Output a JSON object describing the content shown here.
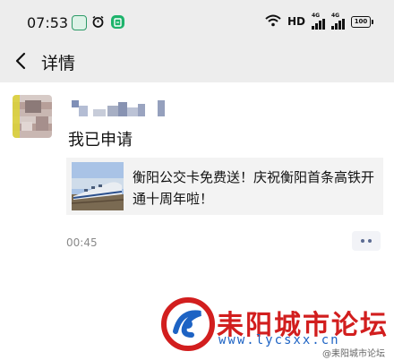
{
  "status_bar": {
    "time": "07:53",
    "hd_label": "HD",
    "signal_label_1": "4G",
    "signal_label_2": "4G",
    "battery": "100"
  },
  "nav": {
    "title": "详情"
  },
  "post": {
    "text": "我已申请",
    "time": "00:45",
    "link": {
      "title": "衡阳公交卡免费送！庆祝衡阳首条高铁开通十周年啦！"
    }
  },
  "watermark": {
    "site_name": "耒阳城市论坛",
    "url": "www.lycsxx.cn",
    "weibo": "@耒阳城市论坛"
  },
  "colors": {
    "bar_bg": "#ededed",
    "accent_red": "#d21e1e",
    "accent_blue": "#1d63c4"
  }
}
